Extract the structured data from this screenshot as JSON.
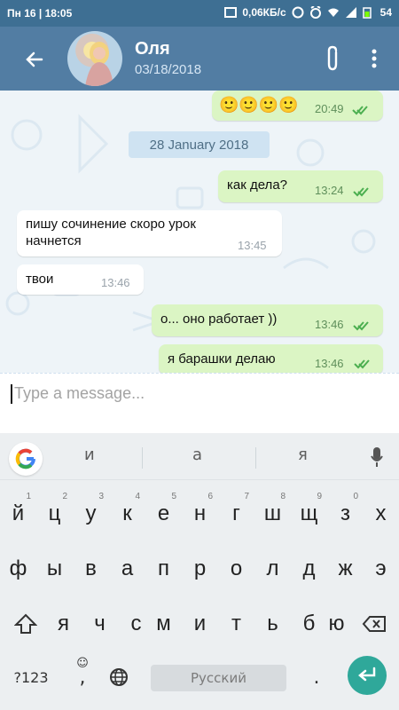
{
  "status_bar": {
    "left": "Пн 16 | 18:05",
    "speed": "0,06КБ/с",
    "battery": "54"
  },
  "header": {
    "name": "Оля",
    "date": "03/18/2018",
    "colors": {
      "bar": "#527da3",
      "status": "#3e6f93"
    }
  },
  "chat": {
    "first_message": {
      "emojis": "🙂🙂🙂🙂",
      "time": "20:49"
    },
    "date_chip": "28 January 2018",
    "messages": [
      {
        "direction": "out",
        "text": "как дела?",
        "time": "13:24"
      },
      {
        "direction": "in",
        "text": "пишу сочинение скоро урок начнется",
        "time": "13:45"
      },
      {
        "direction": "in",
        "text": "твои",
        "time": "13:46"
      },
      {
        "direction": "out",
        "text": "о... оно работает ))",
        "time": "13:46"
      },
      {
        "direction": "out",
        "text": "я барашки делаю",
        "time": "13:46"
      }
    ]
  },
  "input": {
    "placeholder": "Type a message..."
  },
  "keyboard": {
    "suggestions": [
      "и",
      "а",
      "я"
    ],
    "row1": [
      "й",
      "ц",
      "у",
      "к",
      "е",
      "н",
      "г",
      "ш",
      "щ",
      "з",
      "х"
    ],
    "row1_numbers": [
      "1",
      "2",
      "3",
      "4",
      "5",
      "6",
      "7",
      "8",
      "9",
      "0",
      ""
    ],
    "row2": [
      "ф",
      "ы",
      "в",
      "а",
      "п",
      "р",
      "о",
      "л",
      "д",
      "ж",
      "э"
    ],
    "row3": [
      "я",
      "ч",
      "с",
      "м",
      "и",
      "т",
      "ь",
      "б",
      "ю"
    ],
    "symbols_key": "?123",
    "comma": ",",
    "space": "Русский",
    "period": "."
  }
}
